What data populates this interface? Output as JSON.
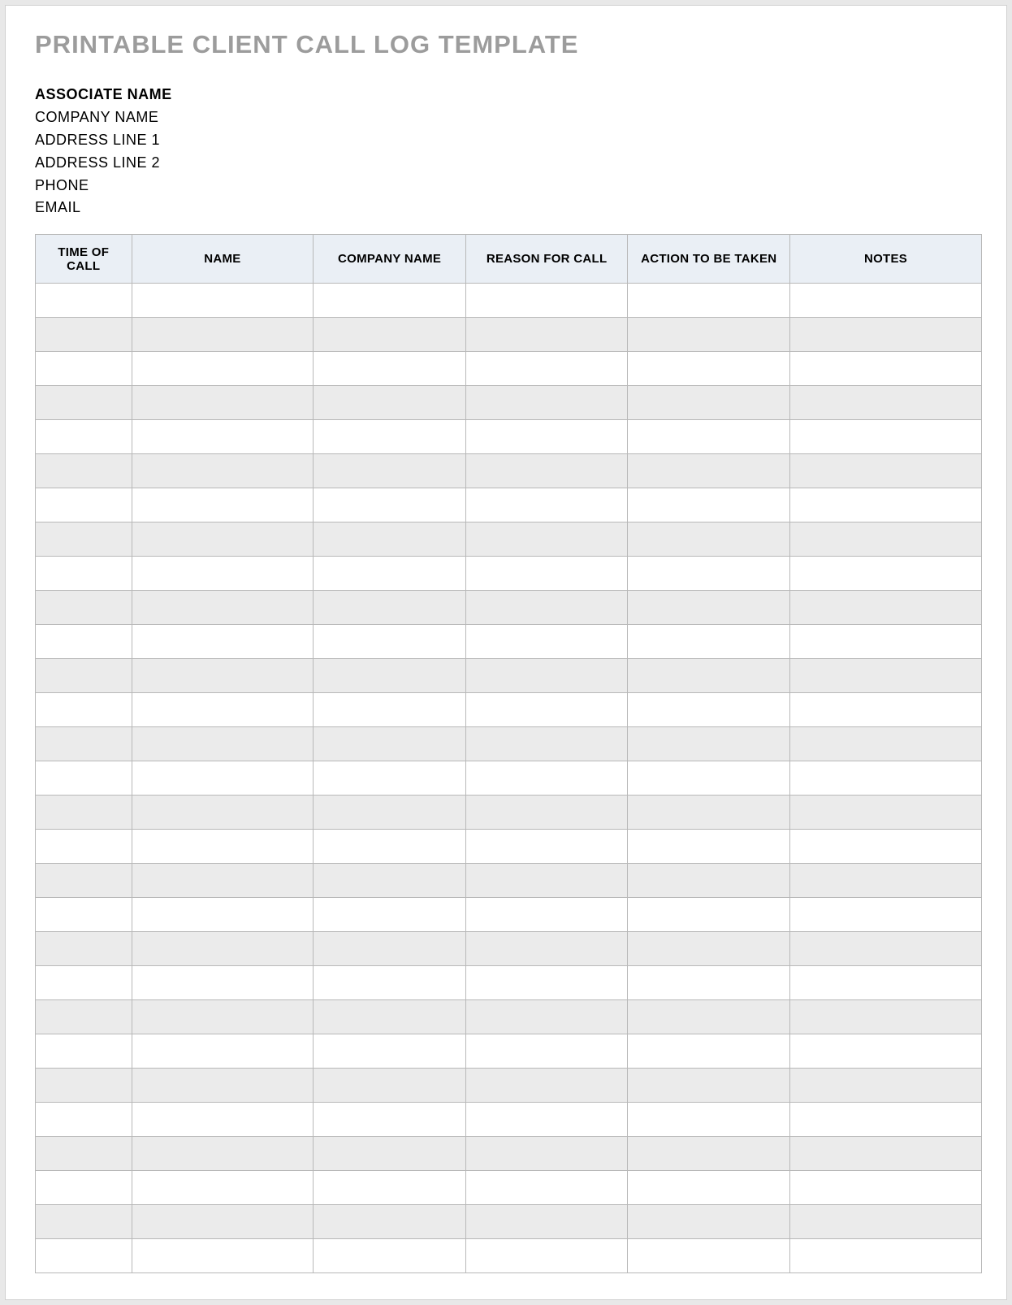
{
  "title": "PRINTABLE CLIENT CALL LOG TEMPLATE",
  "info": {
    "associate": "ASSOCIATE NAME",
    "company": "COMPANY NAME",
    "addr1": "ADDRESS LINE 1",
    "addr2": "ADDRESS LINE 2",
    "phone": "PHONE",
    "email": "EMAIL"
  },
  "columns": {
    "time": "TIME OF CALL",
    "name": "NAME",
    "company": "COMPANY NAME",
    "reason": "REASON FOR CALL",
    "action": "ACTION TO BE TAKEN",
    "notes": "NOTES"
  },
  "rows": [
    {
      "time": "",
      "name": "",
      "company": "",
      "reason": "",
      "action": "",
      "notes": ""
    },
    {
      "time": "",
      "name": "",
      "company": "",
      "reason": "",
      "action": "",
      "notes": ""
    },
    {
      "time": "",
      "name": "",
      "company": "",
      "reason": "",
      "action": "",
      "notes": ""
    },
    {
      "time": "",
      "name": "",
      "company": "",
      "reason": "",
      "action": "",
      "notes": ""
    },
    {
      "time": "",
      "name": "",
      "company": "",
      "reason": "",
      "action": "",
      "notes": ""
    },
    {
      "time": "",
      "name": "",
      "company": "",
      "reason": "",
      "action": "",
      "notes": ""
    },
    {
      "time": "",
      "name": "",
      "company": "",
      "reason": "",
      "action": "",
      "notes": ""
    },
    {
      "time": "",
      "name": "",
      "company": "",
      "reason": "",
      "action": "",
      "notes": ""
    },
    {
      "time": "",
      "name": "",
      "company": "",
      "reason": "",
      "action": "",
      "notes": ""
    },
    {
      "time": "",
      "name": "",
      "company": "",
      "reason": "",
      "action": "",
      "notes": ""
    },
    {
      "time": "",
      "name": "",
      "company": "",
      "reason": "",
      "action": "",
      "notes": ""
    },
    {
      "time": "",
      "name": "",
      "company": "",
      "reason": "",
      "action": "",
      "notes": ""
    },
    {
      "time": "",
      "name": "",
      "company": "",
      "reason": "",
      "action": "",
      "notes": ""
    },
    {
      "time": "",
      "name": "",
      "company": "",
      "reason": "",
      "action": "",
      "notes": ""
    },
    {
      "time": "",
      "name": "",
      "company": "",
      "reason": "",
      "action": "",
      "notes": ""
    },
    {
      "time": "",
      "name": "",
      "company": "",
      "reason": "",
      "action": "",
      "notes": ""
    },
    {
      "time": "",
      "name": "",
      "company": "",
      "reason": "",
      "action": "",
      "notes": ""
    },
    {
      "time": "",
      "name": "",
      "company": "",
      "reason": "",
      "action": "",
      "notes": ""
    },
    {
      "time": "",
      "name": "",
      "company": "",
      "reason": "",
      "action": "",
      "notes": ""
    },
    {
      "time": "",
      "name": "",
      "company": "",
      "reason": "",
      "action": "",
      "notes": ""
    },
    {
      "time": "",
      "name": "",
      "company": "",
      "reason": "",
      "action": "",
      "notes": ""
    },
    {
      "time": "",
      "name": "",
      "company": "",
      "reason": "",
      "action": "",
      "notes": ""
    },
    {
      "time": "",
      "name": "",
      "company": "",
      "reason": "",
      "action": "",
      "notes": ""
    },
    {
      "time": "",
      "name": "",
      "company": "",
      "reason": "",
      "action": "",
      "notes": ""
    },
    {
      "time": "",
      "name": "",
      "company": "",
      "reason": "",
      "action": "",
      "notes": ""
    },
    {
      "time": "",
      "name": "",
      "company": "",
      "reason": "",
      "action": "",
      "notes": ""
    },
    {
      "time": "",
      "name": "",
      "company": "",
      "reason": "",
      "action": "",
      "notes": ""
    },
    {
      "time": "",
      "name": "",
      "company": "",
      "reason": "",
      "action": "",
      "notes": ""
    },
    {
      "time": "",
      "name": "",
      "company": "",
      "reason": "",
      "action": "",
      "notes": ""
    }
  ]
}
